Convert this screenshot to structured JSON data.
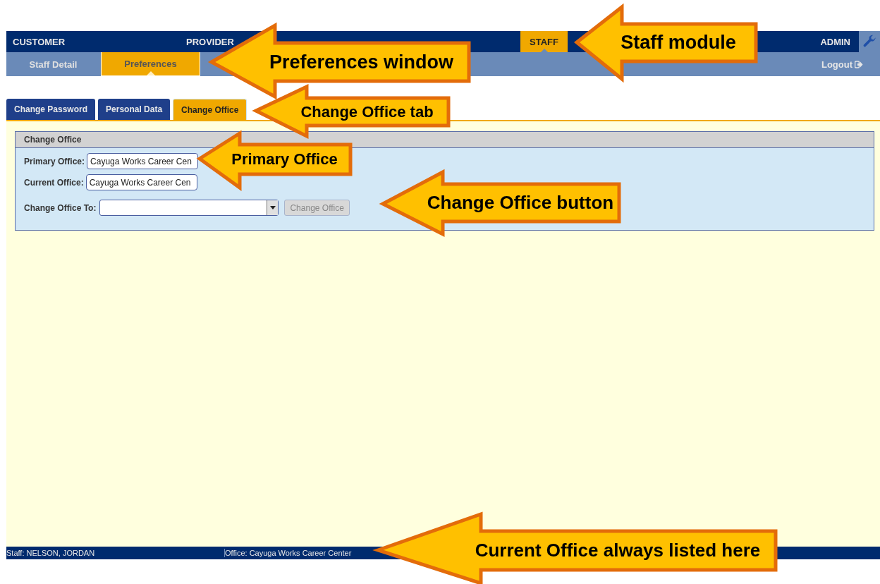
{
  "top_nav": [
    {
      "label": "CUSTOMER",
      "selected": false
    },
    {
      "label": "PROVIDER",
      "selected": false
    },
    {
      "label": "STAFF",
      "selected": true
    },
    {
      "label": "ADMIN",
      "selected": false
    }
  ],
  "sub_nav": [
    {
      "label": "Staff Detail",
      "selected": false
    },
    {
      "label": "Preferences",
      "selected": true
    }
  ],
  "logout": "Logout",
  "tabs": [
    {
      "label": "Change Password",
      "selected": false
    },
    {
      "label": "Personal Data",
      "selected": false
    },
    {
      "label": "Change Office",
      "selected": true
    }
  ],
  "panel": {
    "title": "Change Office",
    "fields": [
      {
        "label": "Primary Office:",
        "value": "Cayuga Works Career Cen"
      },
      {
        "label": "Current Office:",
        "value": "Cayuga Works Career Cen"
      }
    ],
    "change_to": {
      "label": "Change Office To:"
    },
    "button": {
      "label": "Change Office",
      "disabled": true
    }
  },
  "status_bar": {
    "staff": "Staff: NELSON, JORDAN",
    "office": "Office: Cayuga Works Career Center"
  },
  "callouts": [
    {
      "text": "Staff module"
    },
    {
      "text": "Preferences window"
    },
    {
      "text": "Change Office tab"
    },
    {
      "text": "Primary Office"
    },
    {
      "text": "Change Office button"
    },
    {
      "text": "Current Office always listed here"
    }
  ]
}
